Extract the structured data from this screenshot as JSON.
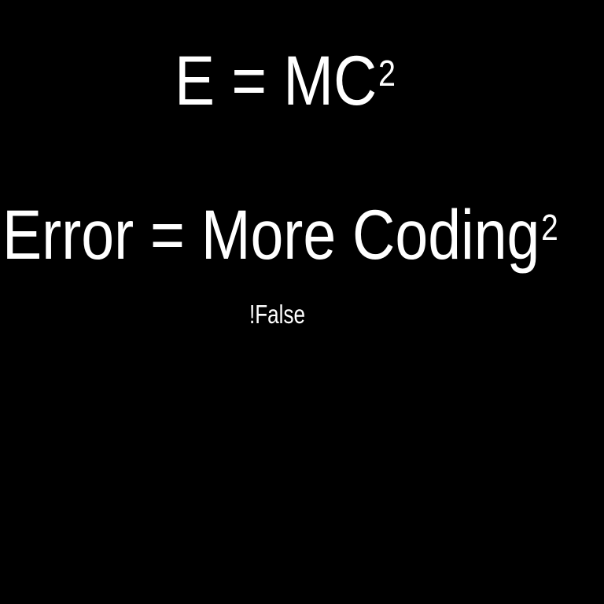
{
  "equation_main": {
    "lhs": "E = MC",
    "exponent": "2"
  },
  "equation_joke": {
    "lhs": "Error = More Coding",
    "exponent": "2"
  },
  "caption": "!False",
  "colors": {
    "background": "#000000",
    "text": "#ffffff"
  }
}
